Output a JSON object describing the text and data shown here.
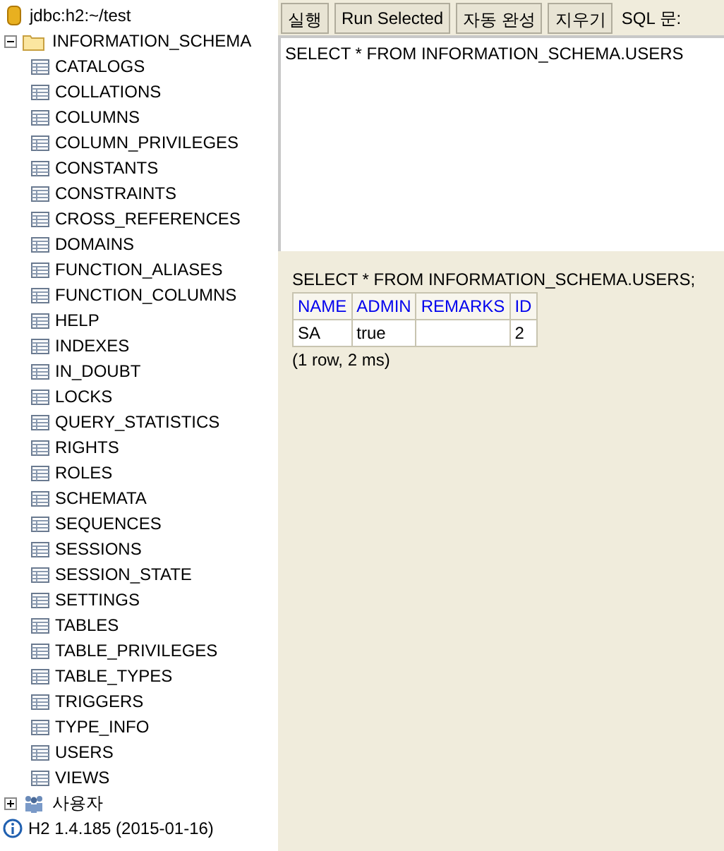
{
  "tree": {
    "connection": "jdbc:h2:~/test",
    "nodes": [
      {
        "label": "INFORMATION_SCHEMA",
        "kind": "schema",
        "expanded": true,
        "children": [
          {
            "label": "CATALOGS"
          },
          {
            "label": "COLLATIONS"
          },
          {
            "label": "COLUMNS"
          },
          {
            "label": "COLUMN_PRIVILEGES"
          },
          {
            "label": "CONSTANTS"
          },
          {
            "label": "CONSTRAINTS"
          },
          {
            "label": "CROSS_REFERENCES"
          },
          {
            "label": "DOMAINS"
          },
          {
            "label": "FUNCTION_ALIASES"
          },
          {
            "label": "FUNCTION_COLUMNS"
          },
          {
            "label": "HELP"
          },
          {
            "label": "INDEXES"
          },
          {
            "label": "IN_DOUBT"
          },
          {
            "label": "LOCKS"
          },
          {
            "label": "QUERY_STATISTICS"
          },
          {
            "label": "RIGHTS"
          },
          {
            "label": "ROLES"
          },
          {
            "label": "SCHEMATA"
          },
          {
            "label": "SEQUENCES"
          },
          {
            "label": "SESSIONS"
          },
          {
            "label": "SESSION_STATE"
          },
          {
            "label": "SETTINGS"
          },
          {
            "label": "TABLES"
          },
          {
            "label": "TABLE_PRIVILEGES"
          },
          {
            "label": "TABLE_TYPES"
          },
          {
            "label": "TRIGGERS"
          },
          {
            "label": "TYPE_INFO"
          },
          {
            "label": "USERS"
          },
          {
            "label": "VIEWS"
          }
        ]
      },
      {
        "label": "사용자",
        "kind": "users",
        "expanded": false
      }
    ],
    "version": "H2 1.4.185 (2015-01-16)"
  },
  "toolbar": {
    "buttons": [
      "실행",
      "Run Selected",
      "자동 완성",
      "지우기"
    ],
    "label": "SQL 문:"
  },
  "editor": {
    "value": "SELECT * FROM INFORMATION_SCHEMA.USERS"
  },
  "result": {
    "statement": "SELECT * FROM INFORMATION_SCHEMA.USERS;",
    "columns": [
      "NAME",
      "ADMIN",
      "REMARKS",
      "ID"
    ],
    "rows": [
      [
        "SA",
        "true",
        "",
        "2"
      ]
    ],
    "summary": "(1 row, 2 ms)"
  }
}
